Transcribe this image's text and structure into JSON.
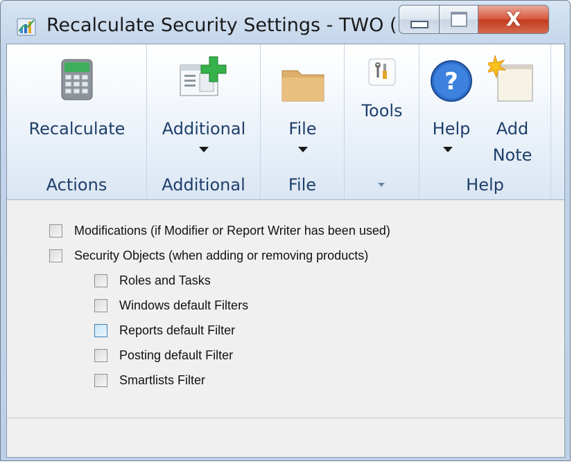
{
  "window": {
    "title": "Recalculate Security Settings  -  TWO (...",
    "close_glyph": "X"
  },
  "ribbon": {
    "groups": [
      {
        "label": "Actions",
        "buttons": [
          {
            "label": "Recalculate",
            "icon": "calculator-icon"
          }
        ]
      },
      {
        "label": "Additional",
        "buttons": [
          {
            "label": "Additional",
            "icon": "window-add-icon",
            "dropdown": true
          }
        ]
      },
      {
        "label": "File",
        "buttons": [
          {
            "label": "File",
            "icon": "folder-icon",
            "dropdown": true
          }
        ]
      },
      {
        "label": "",
        "buttons": [
          {
            "label": "Tools",
            "icon": "tools-icon"
          }
        ]
      },
      {
        "label": "Help",
        "buttons": [
          {
            "label": "Help",
            "icon": "help-icon",
            "dropdown": true
          },
          {
            "label_line1": "Add",
            "label_line2": "Note",
            "icon": "note-icon"
          }
        ]
      }
    ]
  },
  "options": [
    {
      "label": "Modifications (if Modifier or Report Writer has been used)",
      "checked": false
    },
    {
      "label": "Security Objects (when adding or removing products)",
      "checked": false
    },
    {
      "label": "Roles and Tasks",
      "checked": false
    },
    {
      "label": "Windows default Filters",
      "checked": false
    },
    {
      "label": "Reports default Filter",
      "checked": false,
      "hovered": true
    },
    {
      "label": "Posting default Filter",
      "checked": false
    },
    {
      "label": "Smartlists Filter",
      "checked": false
    }
  ],
  "colors": {
    "ribbon_text": "#1e3f6a",
    "close_button": "#c9452b",
    "hover_checkbox": "#c9e5f7"
  }
}
